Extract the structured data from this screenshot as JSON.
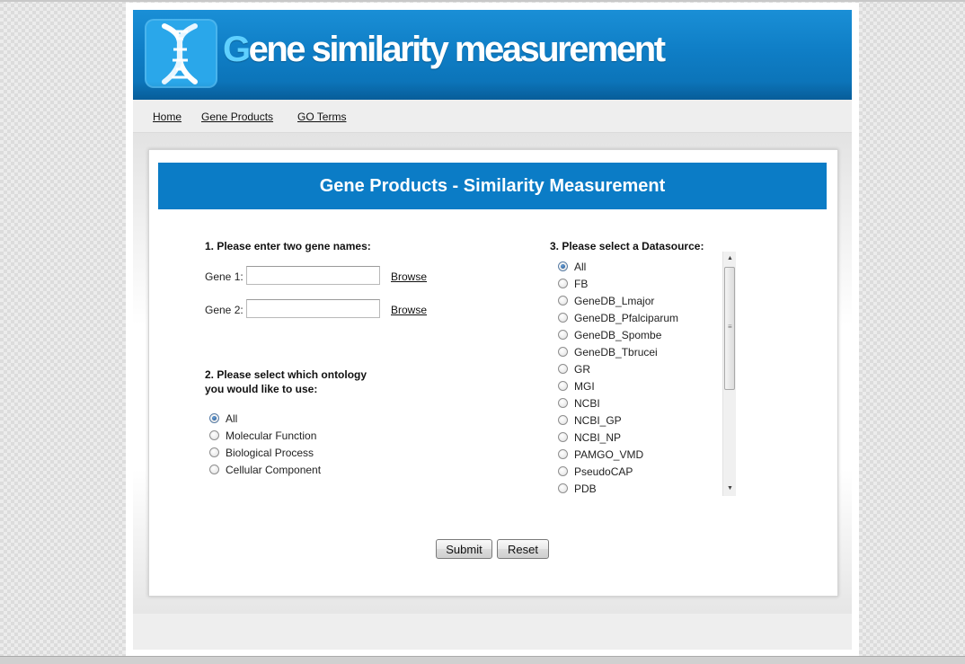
{
  "header": {
    "title_first_letter": "G",
    "title_rest": "ene similarity measurement",
    "logo_icon": "dna-helix-icon"
  },
  "nav": {
    "items": [
      {
        "label": "Home"
      },
      {
        "label": "Gene Products"
      },
      {
        "label": "GO Terms"
      }
    ]
  },
  "main": {
    "banner": "Gene Products - Similarity Measurement",
    "genes": {
      "heading": "1. Please enter two gene names:",
      "gene1": {
        "label": "Gene 1:",
        "value": "",
        "browse": "Browse"
      },
      "gene2": {
        "label": "Gene 2:",
        "value": "",
        "browse": "Browse"
      }
    },
    "ontology": {
      "heading_line1": "2. Please select which ontology",
      "heading_line2": "you would like to use:",
      "selected": "All",
      "options": [
        "All",
        "Molecular Function",
        "Biological Process",
        "Cellular Component"
      ]
    },
    "datasource": {
      "heading": "3. Please select a Datasource:",
      "selected": "All",
      "options": [
        "All",
        "FB",
        "GeneDB_Lmajor",
        "GeneDB_Pfalciparum",
        "GeneDB_Spombe",
        "GeneDB_Tbrucei",
        "GR",
        "MGI",
        "NCBI",
        "NCBI_GP",
        "NCBI_NP",
        "PAMGO_VMD",
        "PseudoCAP",
        "PDB"
      ]
    },
    "buttons": {
      "submit": "Submit",
      "reset": "Reset"
    }
  },
  "colors": {
    "header_blue": "#0f7ec6",
    "banner_blue": "#0b7cc6",
    "title_accent": "#5fd0ff"
  }
}
